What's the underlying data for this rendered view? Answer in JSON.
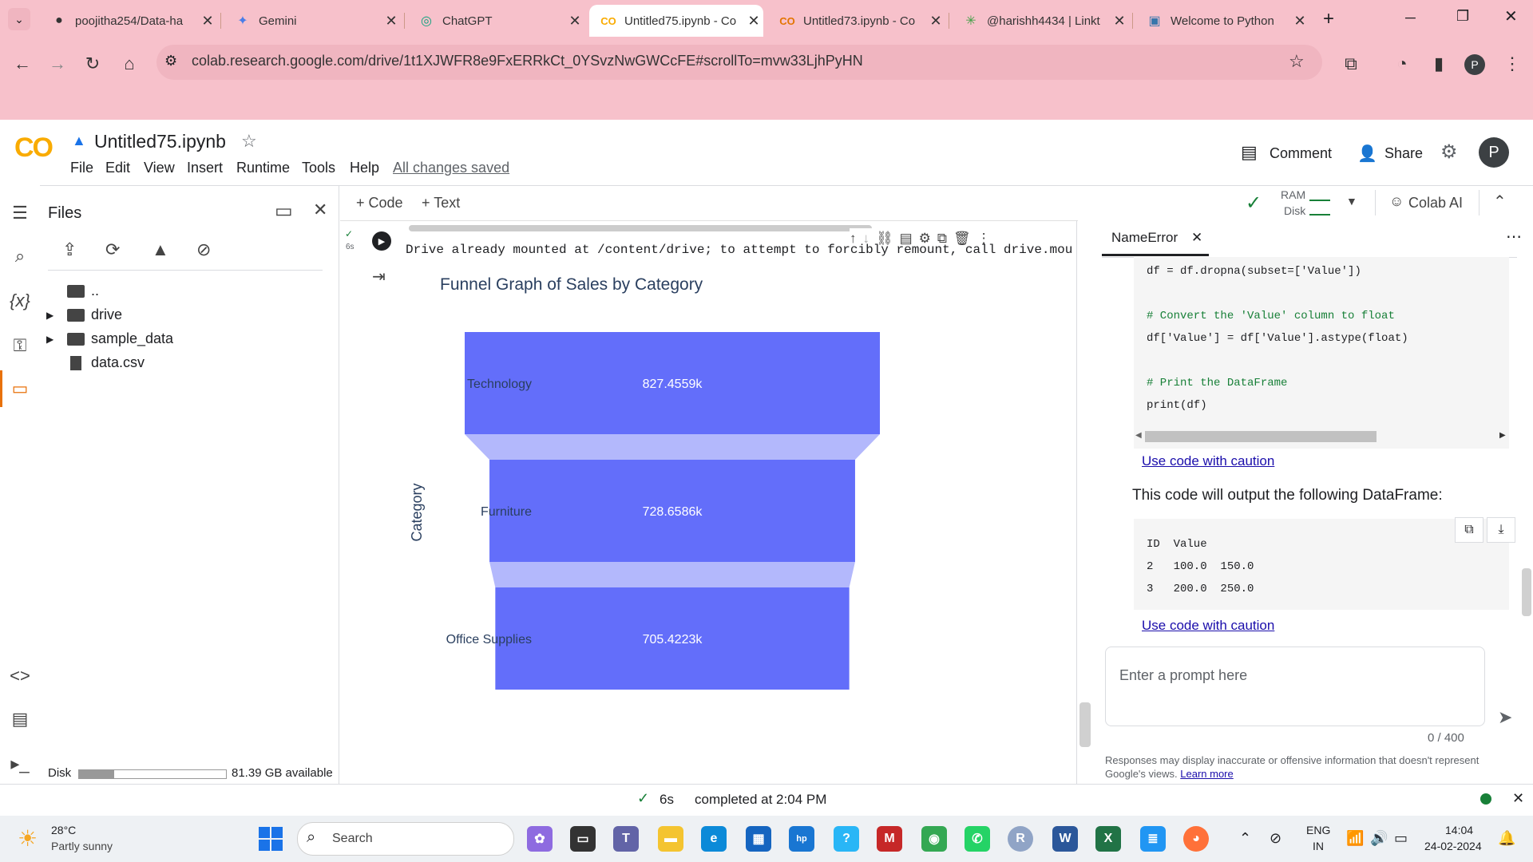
{
  "browser": {
    "tabs": [
      {
        "title": "poojitha254/Data-ha",
        "icon": "github-icon"
      },
      {
        "title": "Gemini",
        "icon": "gemini-icon"
      },
      {
        "title": "ChatGPT",
        "icon": "chatgpt-icon"
      },
      {
        "title": "Untitled75.ipynb - Co",
        "icon": "colab-icon"
      },
      {
        "title": "Untitled73.ipynb - Co",
        "icon": "colab-icon"
      },
      {
        "title": "@harishh4434 | Linkt",
        "icon": "linktree-icon"
      },
      {
        "title": "Welcome to Python",
        "icon": "python-icon"
      }
    ],
    "url": "colab.research.google.com/drive/1t1XJWFR8e9FxERRkCt_0YSvzNwGWCcFE#scrollTo=mvw33LjhPyHN",
    "profile_initial": "P"
  },
  "colab": {
    "logo": "CO",
    "notebook_name": "Untitled75.ipynb",
    "menu": [
      "File",
      "Edit",
      "View",
      "Insert",
      "Runtime",
      "Tools",
      "Help"
    ],
    "save_status": "All changes saved",
    "comment_label": "Comment",
    "share_label": "Share",
    "user_initial": "P",
    "add_code": "+ Code",
    "add_text": "+ Text",
    "ram_label": "RAM",
    "disk_label": "Disk",
    "colab_ai": "Colab AI"
  },
  "files": {
    "title": "Files",
    "items": [
      {
        "name": "..",
        "type": "up"
      },
      {
        "name": "drive",
        "type": "folder"
      },
      {
        "name": "sample_data",
        "type": "folder"
      },
      {
        "name": "data.csv",
        "type": "file"
      }
    ],
    "disk_label": "Disk",
    "disk_available": "81.39 GB available",
    "disk_fraction": 0.24
  },
  "cell": {
    "exec_time": "6s",
    "output_line": "Drive already mounted at /content/drive; to attempt to forcibly remount, call drive.mou"
  },
  "chart_data": {
    "type": "funnel",
    "title": "Funnel Graph of Sales by Category",
    "ylabel": "Category",
    "categories": [
      "Technology",
      "Furniture",
      "Office Supplies"
    ],
    "values": [
      827455.9,
      728658.6,
      705422.3
    ],
    "value_labels": [
      "827.4559k",
      "728.6586k",
      "705.4223k"
    ],
    "bar_color": "#636efa",
    "connector_color": "#b3b8fc"
  },
  "ai_panel": {
    "tab_label": "NameError",
    "code_lines": [
      {
        "t": "df = df.dropna(subset=['Value'])",
        "k": "code"
      },
      {
        "t": "",
        "k": "blank"
      },
      {
        "t": "# Convert the 'Value' column to float",
        "k": "comment"
      },
      {
        "t": "df['Value'] = df['Value'].astype(float)",
        "k": "code"
      },
      {
        "t": "",
        "k": "blank"
      },
      {
        "t": "# Print the DataFrame",
        "k": "comment"
      },
      {
        "t": "print(df)",
        "k": "code"
      }
    ],
    "use_code": "Use code with caution",
    "explanation": "This code will output the following DataFrame:",
    "df_output": [
      "ID  Value",
      "2   100.0  150.0",
      "3   200.0  250.0"
    ],
    "use_code_2": "Use code with caution",
    "prompt_placeholder": "Enter a prompt here",
    "char_count": "0 / 400",
    "disclaimer": "Responses may display inaccurate or offensive information that doesn't represent Google's views.",
    "learn_more": "Learn more"
  },
  "status_bar": {
    "time": "6s",
    "completed": "completed at 2:04 PM"
  },
  "taskbar": {
    "weather_temp": "28°C",
    "weather_desc": "Partly sunny",
    "search": "Search",
    "lang": "ENG",
    "region": "IN",
    "clock": "14:04",
    "date": "24-02-2024"
  }
}
